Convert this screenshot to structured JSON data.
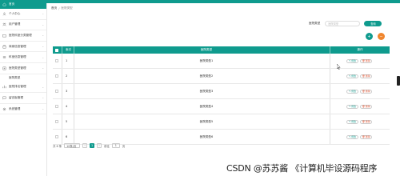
{
  "sidebar": {
    "items": [
      {
        "label": "首页",
        "icon": "home-icon",
        "active": true
      },
      {
        "label": "个人中心",
        "icon": "user-icon"
      },
      {
        "label": "用户管理",
        "icon": "users-icon"
      },
      {
        "label": "医院科室分类管理",
        "icon": "folder-icon"
      },
      {
        "label": "商家信息管理",
        "icon": "shop-icon"
      },
      {
        "label": "科室信息管理",
        "icon": "list-icon"
      },
      {
        "label": "医院类型管理",
        "icon": "hospital-icon"
      }
    ],
    "subitem": "医院类型",
    "items_after": [
      {
        "label": "医院排名管理",
        "icon": "rank-icon"
      },
      {
        "label": "留言板管理",
        "icon": "message-icon"
      },
      {
        "label": "系统管理",
        "icon": "settings-icon"
      }
    ]
  },
  "breadcrumb": {
    "home": "首页",
    "current": "医院类型"
  },
  "search": {
    "label": "医院类型",
    "placeholder": "医院类型",
    "button": "查询"
  },
  "actions": {
    "add": "+",
    "delete": "−"
  },
  "table": {
    "headers": {
      "index": "索引",
      "type": "医院类型",
      "ops": "操作"
    },
    "rows": [
      {
        "index": "1",
        "type": "医院类型1"
      },
      {
        "index": "2",
        "type": "医院类型2"
      },
      {
        "index": "3",
        "type": "医院类型3"
      },
      {
        "index": "4",
        "type": "医院类型4"
      },
      {
        "index": "5",
        "type": "医院类型5"
      },
      {
        "index": "6",
        "type": "医院类型6"
      }
    ],
    "edit_label": "修改",
    "delete_label": "删除"
  },
  "pager": {
    "total": "共 6 条",
    "page_size": "10条/页",
    "prev": "‹",
    "page": "1",
    "next": "›",
    "goto": "前往",
    "goto_value": "1",
    "unit": "页"
  },
  "watermark": "CSDN @苏苏酱  《计算机毕设源码程序"
}
